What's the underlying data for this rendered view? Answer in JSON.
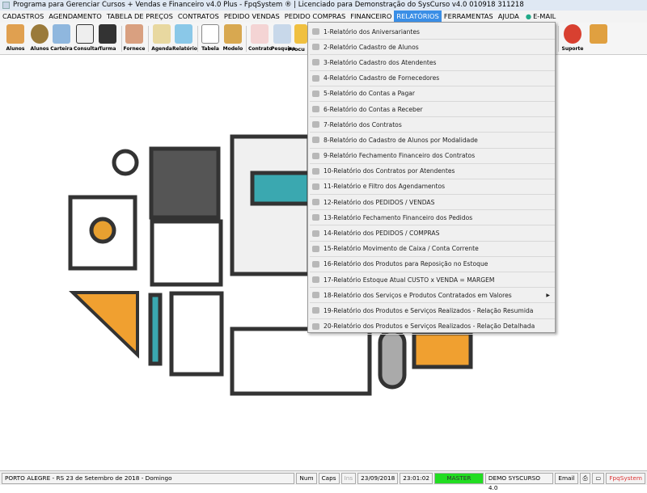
{
  "title": "Programa para Gerenciar Cursos + Vendas e Financeiro v4.0 Plus - FpqSystem ® | Licenciado para  Demonstração do SysCurso v4.0 010918 311218",
  "menubar": [
    "CADASTROS",
    "AGENDAMENTO",
    "TABELA DE PREÇOS",
    "CONTRATOS",
    "PEDIDO VENDAS",
    "PEDIDO COMPRAS",
    "FINANCEIRO",
    "RELATÓRIOS",
    "FERRAMENTAS",
    "AJUDA",
    "E-MAIL"
  ],
  "toolbar": [
    "Alunos",
    "Alunos",
    "Carteira",
    "Consultar",
    "Turma",
    "Fornece",
    "Agenda",
    "Relatório",
    "Tabela",
    "Modelo",
    "Contrato",
    "Pesquisa",
    "Procu",
    "Suporte",
    ""
  ],
  "menu_items": [
    "1-Relatório dos Aniversariantes",
    "2-Relatório Cadastro de Alunos",
    "3-Relatório Cadastro dos Atendentes",
    "4-Relatório Cadastro de Fornecedores",
    "5-Relatório do Contas a Pagar",
    "6-Relatório do Contas a Receber",
    "7-Relatório dos Contratos",
    "8-Relatório do Cadastro de Alunos por Modalidade",
    "9-Relatório Fechamento Financeiro dos Contratos",
    "10-Relatório dos Contratos por Atendentes",
    "11-Relatório e Filtro dos Agendamentos",
    "12-Relatório dos PEDIDOS / VENDAS",
    "13-Relatório Fechamento Financeiro dos Pedidos",
    "14-Relatório dos PEDIDOS / COMPRAS",
    "15-Relatório Movimento de Caixa / Conta Corrente",
    "16-Relatório dos Produtos para Reposição no Estoque",
    "17-Relatório Estoque Atual CUSTO x VENDA = MARGEM",
    "18-Relatório dos Serviços e Produtos Contratados em Valores",
    "19-Relatório dos Produtos e Serviços Realizados - Relação Resumida",
    "20-Relatório dos Produtos e Serviços Realizados - Relação Detalhada"
  ],
  "status": {
    "location": "PORTO ALEGRE - RS 23 de Setembro de 2018 - Domingo",
    "num": "Num",
    "caps": "Caps",
    "ins": "Ins",
    "date": "23/09/2018",
    "time": "23:01:02",
    "user": "MASTER",
    "db": "DEMO SYSCURSO 4.0",
    "email": "Email",
    "brand": "FpqSystem"
  },
  "colors": {
    "accent": "#3a8ee6",
    "master": "#22dd22"
  }
}
